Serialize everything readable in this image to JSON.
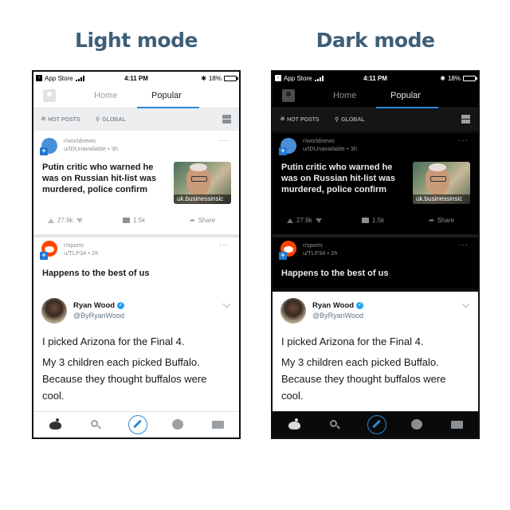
{
  "panels": {
    "light_title": "Light mode",
    "dark_title": "Dark mode"
  },
  "status_bar": {
    "carrier": "App Store",
    "time": "4:11 PM",
    "battery": "18%",
    "battery_level": 0.18
  },
  "nav": {
    "tabs": [
      "Home",
      "Popular"
    ],
    "active_tab": "Popular"
  },
  "filters": {
    "sort": "HOT POSTS",
    "location": "GLOBAL"
  },
  "posts": [
    {
      "subreddit": "r/worldnews",
      "user": "u/IDUnavailable • 3h",
      "title": "Putin critic who warned he was on Russian hit-list was murdered, police confirm",
      "thumbnail_caption": "uk.businessinsic",
      "votes": "27.9k",
      "comments": "1.5k",
      "share": "Share"
    },
    {
      "subreddit": "r/sports",
      "user": "u/TLP34 • 2h",
      "title": "Happens to the best of us"
    }
  ],
  "tweet": {
    "name": "Ryan Wood",
    "handle": "@ByRyanWood",
    "line1": "I picked Arizona for the Final 4.",
    "line2": "My 3 children each picked Buffalo. Because they thought buffalos were cool."
  },
  "tabbar_icons": [
    "home-icon",
    "search-icon",
    "compose-icon",
    "chat-icon",
    "mail-icon"
  ],
  "colors": {
    "accent": "#2d88d8",
    "title": "#3d5f78",
    "verified": "#1da1f2",
    "reddit_orange": "#ff4500"
  }
}
